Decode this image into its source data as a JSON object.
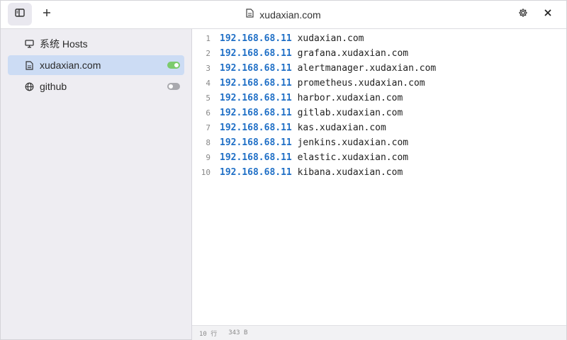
{
  "header": {
    "title": "xudaxian.com",
    "icons": {
      "sidebar_toggle": "sidebar-toggle-icon",
      "add": "plus-icon",
      "file": "file-icon",
      "settings": "gear-icon",
      "close": "close-icon"
    }
  },
  "sidebar": {
    "items": [
      {
        "label": "系统 Hosts",
        "icon": "monitor-icon",
        "toggle": null,
        "active": false
      },
      {
        "label": "xudaxian.com",
        "icon": "file-icon",
        "toggle": "on",
        "active": true
      },
      {
        "label": "github",
        "icon": "globe-icon",
        "toggle": "off",
        "active": false
      }
    ]
  },
  "editor": {
    "lines": [
      {
        "n": "1",
        "ip": "192.168.68.11",
        "host": "xudaxian.com"
      },
      {
        "n": "2",
        "ip": "192.168.68.11",
        "host": "grafana.xudaxian.com"
      },
      {
        "n": "3",
        "ip": "192.168.68.11",
        "host": "alertmanager.xudaxian.com"
      },
      {
        "n": "4",
        "ip": "192.168.68.11",
        "host": "prometheus.xudaxian.com"
      },
      {
        "n": "5",
        "ip": "192.168.68.11",
        "host": "harbor.xudaxian.com"
      },
      {
        "n": "6",
        "ip": "192.168.68.11",
        "host": "gitlab.xudaxian.com"
      },
      {
        "n": "7",
        "ip": "192.168.68.11",
        "host": "kas.xudaxian.com"
      },
      {
        "n": "8",
        "ip": "192.168.68.11",
        "host": "jenkins.xudaxian.com"
      },
      {
        "n": "9",
        "ip": "192.168.68.11",
        "host": "elastic.xudaxian.com"
      },
      {
        "n": "10",
        "ip": "192.168.68.11",
        "host": "kibana.xudaxian.com"
      }
    ]
  },
  "status": {
    "lines": "10 行",
    "size": "343 B"
  },
  "colors": {
    "ip": "#1f6fc6",
    "active_item": "#ccdcf4",
    "toggle_on": "#7ccb6c",
    "toggle_off": "#a9a9ae"
  }
}
